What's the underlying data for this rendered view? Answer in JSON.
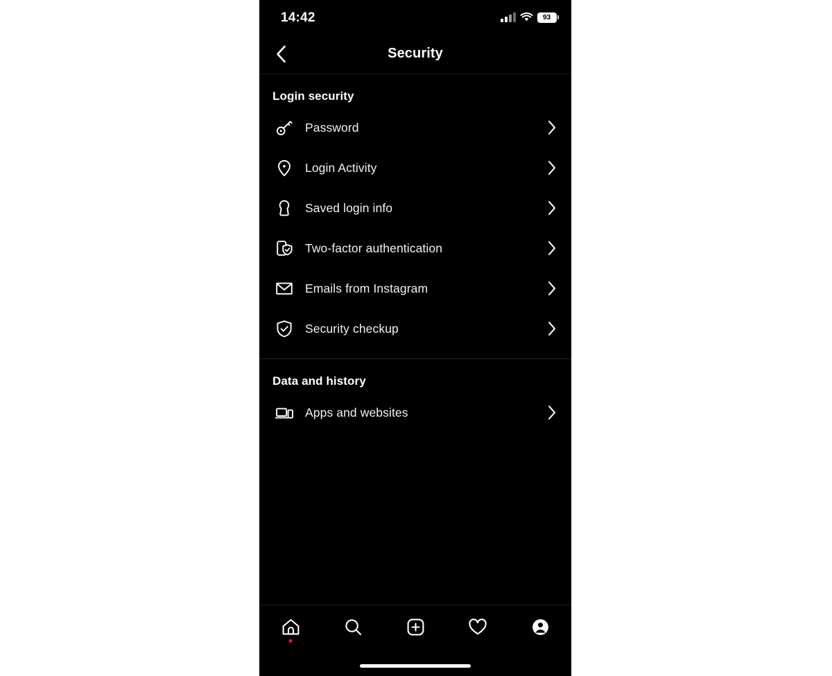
{
  "status_bar": {
    "time": "14:42",
    "signal_icon": "cellular-signal-icon",
    "wifi_icon": "wifi-icon",
    "battery_level": "93"
  },
  "nav": {
    "back_icon": "chevron-left-icon",
    "title": "Security"
  },
  "sections": [
    {
      "title": "Login security",
      "items": [
        {
          "label": "Password",
          "icon": "key-icon",
          "chevron": "chevron-right-icon"
        },
        {
          "label": "Login Activity",
          "icon": "location-pin-icon",
          "chevron": "chevron-right-icon"
        },
        {
          "label": "Saved login info",
          "icon": "keyhole-icon",
          "chevron": "chevron-right-icon"
        },
        {
          "label": "Two-factor authentication",
          "icon": "phone-shield-check-icon",
          "chevron": "chevron-right-icon"
        },
        {
          "label": "Emails from Instagram",
          "icon": "envelope-icon",
          "chevron": "chevron-right-icon"
        },
        {
          "label": "Security checkup",
          "icon": "shield-check-icon",
          "chevron": "chevron-right-icon"
        }
      ]
    },
    {
      "title": "Data and history",
      "items": [
        {
          "label": "Apps and websites",
          "icon": "laptop-phone-icon",
          "chevron": "chevron-right-icon"
        }
      ]
    }
  ],
  "tab_bar": {
    "tabs": [
      {
        "name": "home",
        "icon": "home-icon",
        "badge": true
      },
      {
        "name": "search",
        "icon": "search-icon",
        "badge": false
      },
      {
        "name": "create",
        "icon": "plus-square-icon",
        "badge": false
      },
      {
        "name": "activity",
        "icon": "heart-icon",
        "badge": false
      },
      {
        "name": "profile",
        "icon": "profile-avatar-icon",
        "badge": false
      }
    ],
    "badge_color": "#e8174b",
    "home_indicator": "home-indicator"
  },
  "colors": {
    "background": "#000000",
    "text": "#f2f2f2",
    "divider": "#232323",
    "page_background": "#ffffff"
  }
}
